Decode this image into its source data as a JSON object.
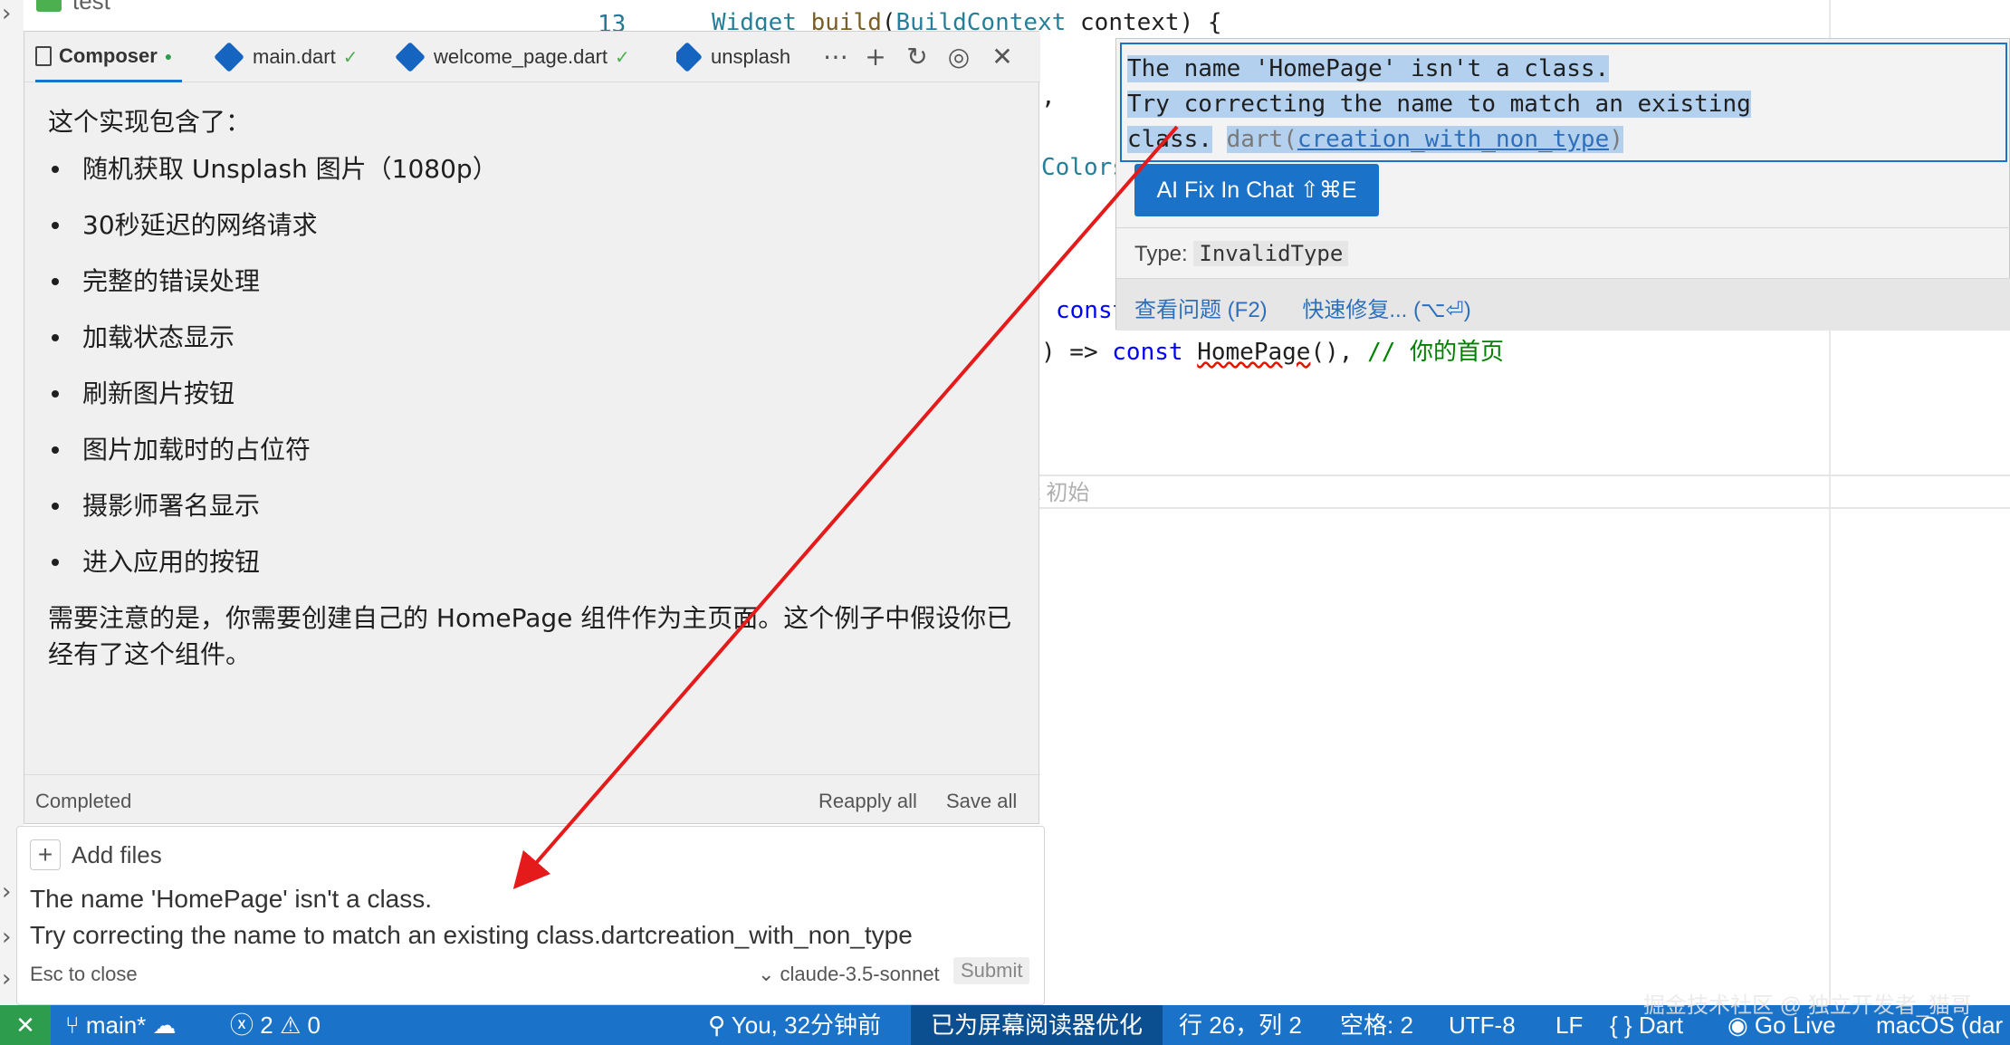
{
  "explorer": {
    "folder_label": "test"
  },
  "editor": {
    "line_number": "13",
    "line1": {
      "a": "Widget ",
      "b": "build",
      "c": "(",
      "d": "BuildContext",
      "e": " context) {"
    },
    "comma": ",",
    "colors_fragment": "Colors",
    "const_fragment": "const",
    "route_line": {
      "a": ") => ",
      "b": "const ",
      "c": "HomePage",
      "d": "(), ",
      "e": "// 你的首页"
    },
    "ghost_text": "t 初始"
  },
  "composer": {
    "tabs": {
      "composer": "Composer",
      "main_dart": "main.dart",
      "welcome": "welcome_page.dart",
      "unsplash": "unsplash"
    },
    "intro": "这个实现包含了：",
    "bullets": [
      "随机获取 Unsplash 图片（1080p）",
      "30秒延迟的网络请求",
      "完整的错误处理",
      "加载状态显示",
      "刷新图片按钮",
      "图片加载时的占位符",
      "摄影师署名显示",
      "进入应用的按钮"
    ],
    "note": "需要注意的是，你需要创建自己的 HomePage 组件作为主页面。这个例子中假设你已经有了这个组件。",
    "status": "Completed",
    "reapply": "Reapply all",
    "save_all": "Save all"
  },
  "input": {
    "add_files": "Add files",
    "line1": "The name 'HomePage' isn't a class.",
    "line2": "Try correcting the name to match an existing class.dartcreation_with_non_type",
    "esc": "Esc to close",
    "model": "claude-3.5-sonnet",
    "submit": "Submit"
  },
  "hover": {
    "line1": "The name 'HomePage' isn't a class.",
    "line2": "Try correcting the name to match an existing",
    "line3_a": "class.",
    "line3_src": "dart",
    "line3_code": "creation_with_non_type",
    "ai_fix": "AI Fix In Chat ⇧⌘E",
    "type_label": "Type:",
    "type_value": "InvalidType",
    "view_problem": "查看问题 (F2)",
    "quick_fix": "快速修复... (⌥⏎)"
  },
  "statusbar": {
    "branch": "main*",
    "errors": "2",
    "warnings": "0",
    "blame": "You, 32分钟前",
    "screen_reader": "已为屏幕阅读器优化",
    "position": "行 26，列 2",
    "spaces": "空格: 2",
    "encoding": "UTF-8",
    "eol": "LF",
    "language": "Dart",
    "go_live": "Go Live",
    "platform": "macOS (dar"
  },
  "watermark": "掘金技术社区 @ 独立开发者_猫哥",
  "colors": {
    "accent": "#1a73c8",
    "arrow": "#e51a1a",
    "remote": "#2e9c4d"
  }
}
